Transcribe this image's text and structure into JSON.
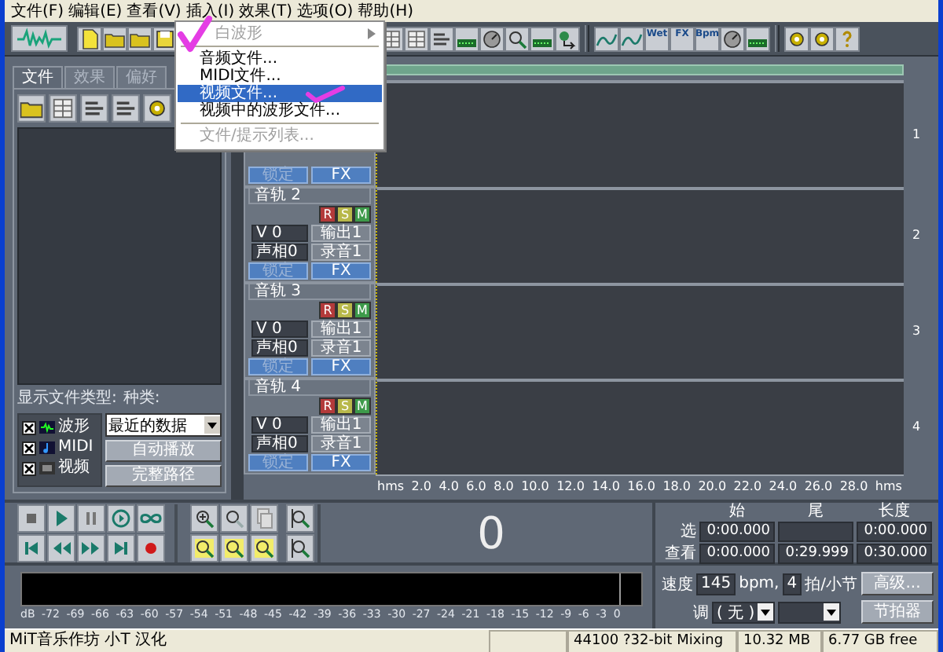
{
  "menu_bar": [
    "文件(F)",
    "编辑(E)",
    "查看(V)",
    "插入(I)",
    "效果(T)",
    "选项(O)",
    "帮助(H)"
  ],
  "insert_menu": {
    "items": [
      {
        "kind": "submenu",
        "label": "白波形",
        "disabled": true,
        "selected": false
      },
      {
        "kind": "separator"
      },
      {
        "kind": "item",
        "label": "音频文件...",
        "disabled": false,
        "selected": false
      },
      {
        "kind": "item",
        "label": "MIDI文件...",
        "disabled": false,
        "selected": false
      },
      {
        "kind": "item",
        "label": "视频文件...",
        "disabled": false,
        "selected": true
      },
      {
        "kind": "item",
        "label": "视频中的波形文件...",
        "disabled": false,
        "selected": false
      },
      {
        "kind": "separator"
      },
      {
        "kind": "item",
        "label": "文件/提示列表...",
        "disabled": true,
        "selected": false
      }
    ]
  },
  "toolbar": {
    "icon_labels": [
      "Wet",
      "FX",
      "Bpm"
    ]
  },
  "left_panel": {
    "tabs": [
      {
        "label": "文件",
        "selected": true
      },
      {
        "label": "效果",
        "selected": false
      },
      {
        "label": "偏好",
        "selected": false
      }
    ],
    "file_types_label": "显示文件类型:",
    "category_label": "种类:",
    "file_types": [
      {
        "kind": "wave",
        "label": "波形",
        "checked": true
      },
      {
        "kind": "midi",
        "label": "MIDI",
        "checked": true
      },
      {
        "kind": "video",
        "label": "视频",
        "checked": true
      }
    ],
    "category": {
      "value": "最近的数据"
    },
    "buttons": [
      "自动播放",
      "完整路径"
    ]
  },
  "tracks": [
    {
      "number": "1",
      "lock": {
        "label": "锁定",
        "disabled": true
      },
      "fx": "FX"
    },
    {
      "number": "2",
      "name": "音轨 2",
      "rsm": [
        {
          "kind": "record",
          "label": "R"
        },
        {
          "kind": "solo",
          "label": "S"
        },
        {
          "kind": "mute",
          "label": "M"
        }
      ],
      "volume": "V 0",
      "output": "输出1",
      "pan": "声相0",
      "record": "录音1",
      "lock": {
        "label": "锁定",
        "disabled": true
      },
      "fx": "FX"
    },
    {
      "number": "3",
      "name": "音轨 3",
      "rsm": [
        {
          "kind": "record",
          "label": "R"
        },
        {
          "kind": "solo",
          "label": "S"
        },
        {
          "kind": "mute",
          "label": "M"
        }
      ],
      "volume": "V 0",
      "output": "输出1",
      "pan": "声相0",
      "record": "录音1",
      "lock": {
        "label": "锁定",
        "disabled": true
      },
      "fx": "FX"
    },
    {
      "number": "4",
      "name": "音轨 4",
      "rsm": [
        {
          "kind": "record",
          "label": "R"
        },
        {
          "kind": "solo",
          "label": "S"
        },
        {
          "kind": "mute",
          "label": "M"
        }
      ],
      "volume": "V 0",
      "output": "输出1",
      "pan": "声相0",
      "record": "录音1",
      "lock": {
        "label": "锁定",
        "disabled": true
      },
      "fx": "FX"
    }
  ],
  "ruler": [
    "hms",
    "2.0",
    "4.0",
    "6.0",
    "8.0",
    "10.0",
    "12.0",
    "14.0",
    "16.0",
    "18.0",
    "20.0",
    "22.0",
    "24.0",
    "26.0",
    "28.0",
    "hms"
  ],
  "time_display": "0",
  "selection": {
    "headers": [
      "始",
      "尾",
      "长度"
    ],
    "rows": [
      {
        "label": "选",
        "begin": "0:00.000",
        "length": "0:00.000"
      },
      {
        "label": "查看",
        "begin": "0:00.000",
        "end": "0:29.999",
        "length": "0:30.000"
      }
    ]
  },
  "meter_scale": [
    "dB",
    "-72",
    "-69",
    "-66",
    "-63",
    "-60",
    "-57",
    "-54",
    "-51",
    "-48",
    "-45",
    "-42",
    "-39",
    "-36",
    "-33",
    "-30",
    "-27",
    "-24",
    "-21",
    "-18",
    "-15",
    "-12",
    "-9",
    "-6",
    "-3",
    "0"
  ],
  "tempo": {
    "tempo_label": "速度",
    "tempo": "145",
    "bpm_label": "bpm,",
    "beats": "4",
    "beats_label": "拍/小节",
    "advanced_button": "高级...",
    "key_label": "调",
    "key": "( 无 )",
    "metronome_button": "节拍器"
  },
  "status_bar": {
    "credit": "MiT音乐作坊 小T 汉化",
    "format": "44100 ?32-bit Mixing",
    "memory": "10.32 MB",
    "disk": "6.77 GB free"
  }
}
